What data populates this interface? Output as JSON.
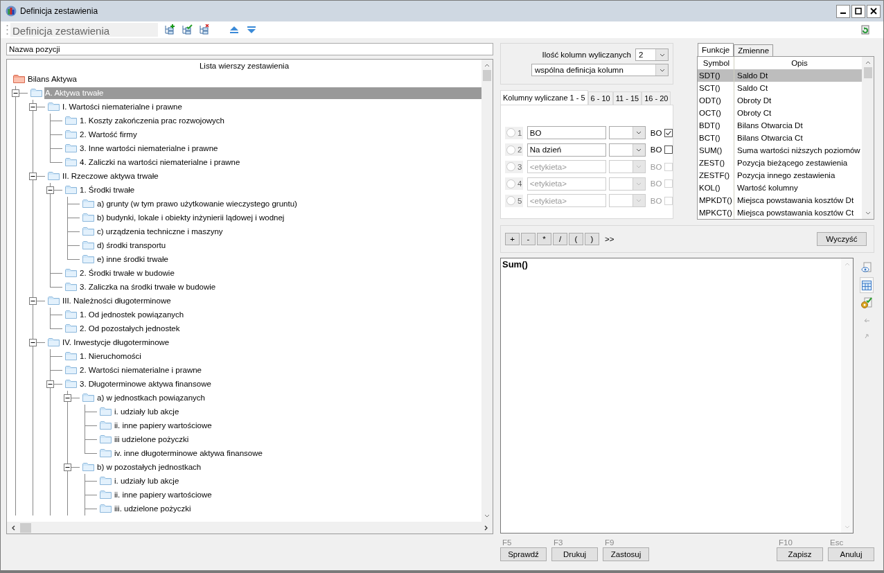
{
  "window": {
    "title": "Definicja zestawienia"
  },
  "toolbar": {
    "title": "Definicja zestawienia"
  },
  "name_field": {
    "value": "Nazwa pozycji"
  },
  "tree": {
    "header": "Lista wierszy zestawienia",
    "items": [
      {
        "label": "Bilans Aktywa",
        "kind": "root",
        "selected": false,
        "children": [
          {
            "label": "A. Aktywa trwałe",
            "kind": "folder",
            "selected": true,
            "expanded": true,
            "continues_below": true,
            "children": [
              {
                "label": "I. Wartości niematerialne i prawne",
                "kind": "folder",
                "selected": false,
                "expanded": true,
                "children": [
                  {
                    "label": "1. Koszty zakończenia prac rozwojowych",
                    "kind": "folder",
                    "selected": false
                  },
                  {
                    "label": "2. Wartość firmy",
                    "kind": "folder",
                    "selected": false
                  },
                  {
                    "label": "3. Inne wartości niematerialne i prawne",
                    "kind": "folder",
                    "selected": false
                  },
                  {
                    "label": "4. Zaliczki na wartości niematerialne i prawne",
                    "kind": "folder",
                    "selected": false
                  }
                ]
              },
              {
                "label": "II. Rzeczowe aktywa trwałe",
                "kind": "folder",
                "selected": false,
                "expanded": true,
                "children": [
                  {
                    "label": "1. Środki trwałe",
                    "kind": "folder",
                    "selected": false,
                    "expanded": true,
                    "children": [
                      {
                        "label": "a) grunty (w tym prawo użytkowanie wieczystego gruntu)",
                        "kind": "folder",
                        "selected": false
                      },
                      {
                        "label": "b) budynki, lokale i obiekty inżynierii lądowej i wodnej",
                        "kind": "folder",
                        "selected": false
                      },
                      {
                        "label": "c) urządzenia techniczne i maszyny",
                        "kind": "folder",
                        "selected": false
                      },
                      {
                        "label": "d) środki transportu",
                        "kind": "folder",
                        "selected": false
                      },
                      {
                        "label": "e) inne środki trwałe",
                        "kind": "folder",
                        "selected": false
                      }
                    ]
                  },
                  {
                    "label": "2. Środki trwałe w budowie",
                    "kind": "folder",
                    "selected": false
                  },
                  {
                    "label": "3. Zaliczka na środki trwałe w budowie",
                    "kind": "folder",
                    "selected": false
                  }
                ]
              },
              {
                "label": "III. Należności długoterminowe",
                "kind": "folder",
                "selected": false,
                "expanded": true,
                "children": [
                  {
                    "label": "1. Od jednostek powiązanych",
                    "kind": "folder",
                    "selected": false
                  },
                  {
                    "label": "2. Od pozostałych jednostek",
                    "kind": "folder",
                    "selected": false
                  }
                ]
              },
              {
                "label": "IV. Inwestycje długoterminowe",
                "kind": "folder",
                "selected": false,
                "expanded": true,
                "continues_below": true,
                "children": [
                  {
                    "label": "1. Nieruchomości",
                    "kind": "folder",
                    "selected": false
                  },
                  {
                    "label": "2. Wartości niematerialne i prawne",
                    "kind": "folder",
                    "selected": false
                  },
                  {
                    "label": "3. Długoterminowe aktywa finansowe",
                    "kind": "folder",
                    "selected": false,
                    "expanded": true,
                    "continues_below": true,
                    "children": [
                      {
                        "label": "a) w jednostkach powiązanych",
                        "kind": "folder",
                        "selected": false,
                        "expanded": true,
                        "children": [
                          {
                            "label": "i. udziały lub akcje",
                            "kind": "folder",
                            "selected": false
                          },
                          {
                            "label": "ii. inne papiery wartościowe",
                            "kind": "folder",
                            "selected": false
                          },
                          {
                            "label": "iii udzielone pożyczki",
                            "kind": "folder",
                            "selected": false
                          },
                          {
                            "label": "iv. inne długoterminowe aktywa finansowe",
                            "kind": "folder",
                            "selected": false
                          }
                        ]
                      },
                      {
                        "label": "b) w pozostałych jednostkach",
                        "kind": "folder",
                        "selected": false,
                        "expanded": true,
                        "continues_below": true,
                        "children": [
                          {
                            "label": "i. udziały lub akcje",
                            "kind": "folder",
                            "selected": false
                          },
                          {
                            "label": "ii. inne papiery wartościowe",
                            "kind": "folder",
                            "selected": false
                          },
                          {
                            "label": "iii. udzielone pożyczki",
                            "kind": "folder",
                            "selected": false,
                            "continues_below": true
                          }
                        ]
                      }
                    ]
                  }
                ]
              }
            ]
          }
        ]
      }
    ]
  },
  "columns_count": {
    "label": "Ilość kolumn wyliczanych",
    "value": "2"
  },
  "definition_mode": {
    "value": "wspólna definicja kolumn"
  },
  "column_tabs": [
    {
      "label": "Kolumny wyliczane 1 - 5",
      "selected": true
    },
    {
      "label": "6 - 10",
      "selected": false
    },
    {
      "label": "11 - 15",
      "selected": false
    },
    {
      "label": "16 - 20",
      "selected": false
    }
  ],
  "column_rows": [
    {
      "number": "1",
      "selected": false,
      "value": "BO",
      "disabled": false,
      "flag_label": "BO",
      "checked": true
    },
    {
      "number": "2",
      "selected": false,
      "value": "Na dzień",
      "disabled": false,
      "flag_label": "BO",
      "checked": false
    },
    {
      "number": "3",
      "selected": false,
      "placeholder": "<etykieta>",
      "disabled": true,
      "flag_label": "BO",
      "checked": false
    },
    {
      "number": "4",
      "selected": false,
      "placeholder": "<etykieta>",
      "disabled": true,
      "flag_label": "BO",
      "checked": false
    },
    {
      "number": "5",
      "selected": false,
      "placeholder": "<etykieta>",
      "disabled": true,
      "flag_label": "BO",
      "checked": false
    }
  ],
  "function_tabs": [
    {
      "label": "Funkcje",
      "selected": true
    },
    {
      "label": "Zmienne",
      "selected": false
    }
  ],
  "functions": {
    "columns": [
      "Symbol",
      "Opis"
    ],
    "rows": [
      {
        "symbol": "SDT()",
        "description": "Saldo Dt",
        "selected": true
      },
      {
        "symbol": "SCT()",
        "description": "Saldo Ct",
        "selected": false
      },
      {
        "symbol": "ODT()",
        "description": "Obroty Dt",
        "selected": false
      },
      {
        "symbol": "OCT()",
        "description": "Obroty Ct",
        "selected": false
      },
      {
        "symbol": "BDT()",
        "description": "Bilans Otwarcia Dt",
        "selected": false
      },
      {
        "symbol": "BCT()",
        "description": "Bilans Otwarcia Ct",
        "selected": false
      },
      {
        "symbol": "SUM()",
        "description": "Suma wartości niższych poziomów",
        "selected": false
      },
      {
        "symbol": "ZEST()",
        "description": "Pozycja bieżącego zestawienia",
        "selected": false
      },
      {
        "symbol": "ZESTF()",
        "description": "Pozycja innego zestawienia",
        "selected": false
      },
      {
        "symbol": "KOL()",
        "description": "Wartość kolumny",
        "selected": false
      },
      {
        "symbol": "MPKDT()",
        "description": "Miejsca powstawania kosztów Dt",
        "selected": false
      },
      {
        "symbol": "MPKCT()",
        "description": "Miejsca powstawania kosztów Ct",
        "selected": false
      }
    ]
  },
  "operators": [
    "+",
    "-",
    "*",
    "/",
    "(",
    ")"
  ],
  "insert_label": ">>",
  "clear_button": "Wyczyść",
  "editor": {
    "value": "Sum()"
  },
  "actions_left": [
    {
      "shortcut": "F5",
      "label": "Sprawdź"
    },
    {
      "shortcut": "F3",
      "label": "Drukuj"
    },
    {
      "shortcut": "F9",
      "label": "Zastosuj"
    }
  ],
  "actions_right": [
    {
      "shortcut": "F10",
      "label": "Zapisz"
    },
    {
      "shortcut": "Esc",
      "label": "Anuluj"
    }
  ]
}
